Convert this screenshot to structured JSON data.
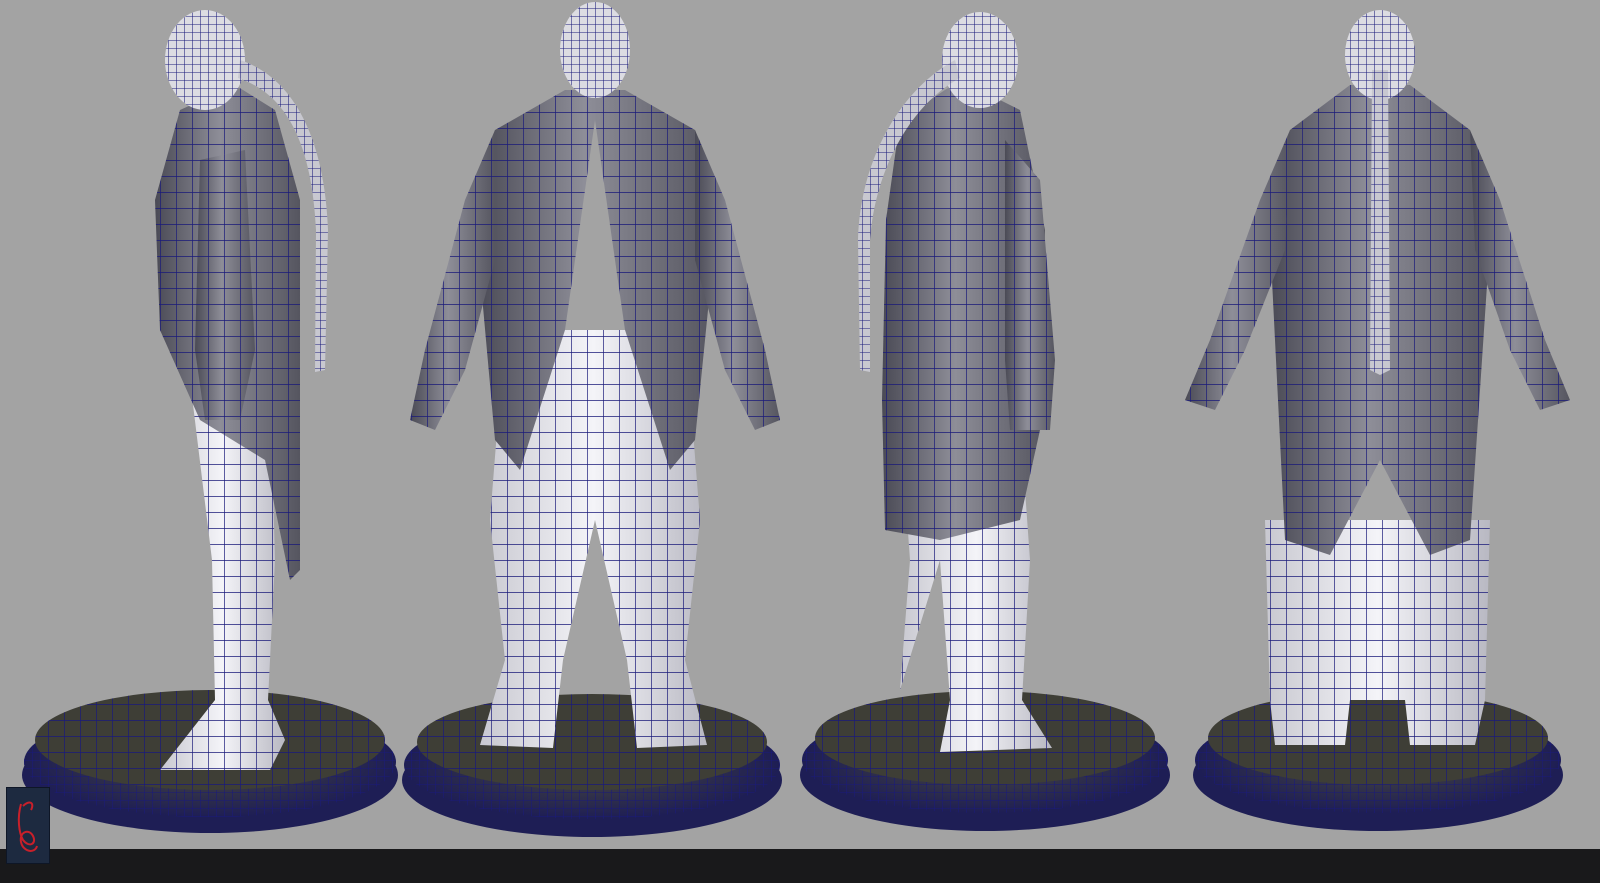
{
  "scene": {
    "views": [
      {
        "name": "side"
      },
      {
        "name": "front"
      },
      {
        "name": "three-quarter-back"
      },
      {
        "name": "back"
      }
    ],
    "colors": {
      "background": "#a3a3a3",
      "wire": "#1a1a7a",
      "coat": "#6a6a74",
      "pants": "#e6e6ea",
      "base": "#2a2a4a",
      "bar": "#19191b"
    }
  },
  "watermark": {
    "logo_icon": "signature-logo-icon"
  }
}
